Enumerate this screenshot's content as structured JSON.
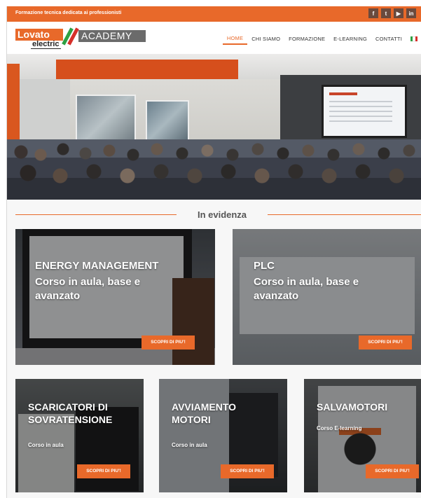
{
  "topbar": {
    "tagline": "Formazione tecnica dedicata ai professionisti",
    "social": [
      {
        "icon": "facebook-icon",
        "glyph": "f"
      },
      {
        "icon": "twitter-icon",
        "glyph": "t"
      },
      {
        "icon": "youtube-icon",
        "glyph": "▶"
      },
      {
        "icon": "linkedin-icon",
        "glyph": "in"
      }
    ]
  },
  "header": {
    "logo": {
      "lovato": "Lovato",
      "electric": "electric",
      "academy": "ACADEMY"
    },
    "nav": [
      {
        "label": "HOME",
        "active": true
      },
      {
        "label": "CHI SIAMO",
        "active": false
      },
      {
        "label": "FORMAZIONE",
        "active": false
      },
      {
        "label": "E-LEARNING",
        "active": false
      },
      {
        "label": "CONTATTI",
        "active": false
      }
    ],
    "language_flag": "italian-flag-icon"
  },
  "section": {
    "title": "In evidenza"
  },
  "cards": [
    {
      "title": "ENERGY MANAGEMENT",
      "subtitle_line1": "Corso in aula, base e",
      "subtitle_line2": "avanzato",
      "button": "SCOPRI DI PIU'!"
    },
    {
      "title": "PLC",
      "subtitle_line1": "Corso in aula, base e",
      "subtitle_line2": "avanzato",
      "button": "SCOPRI DI PIU'!"
    },
    {
      "title_line1": "SCARICATORI DI",
      "title_line2": "SOVRATENSIONE",
      "subtitle": "Corso in aula",
      "button": "SCOPRI DI PIU'!"
    },
    {
      "title_line1": "AVVIAMENTO",
      "title_line2": "MOTORI",
      "subtitle": "Corso in aula",
      "button": "SCOPRI DI PIU'!"
    },
    {
      "title_line1": "SALVAMOTORI",
      "subtitle": "Corso E-learning",
      "button": "SCOPRI DI PIU'!"
    }
  ],
  "colors": {
    "accent": "#e8692a",
    "social_bg": "#6a4a3d",
    "academy_gray": "#6b6b6b"
  }
}
